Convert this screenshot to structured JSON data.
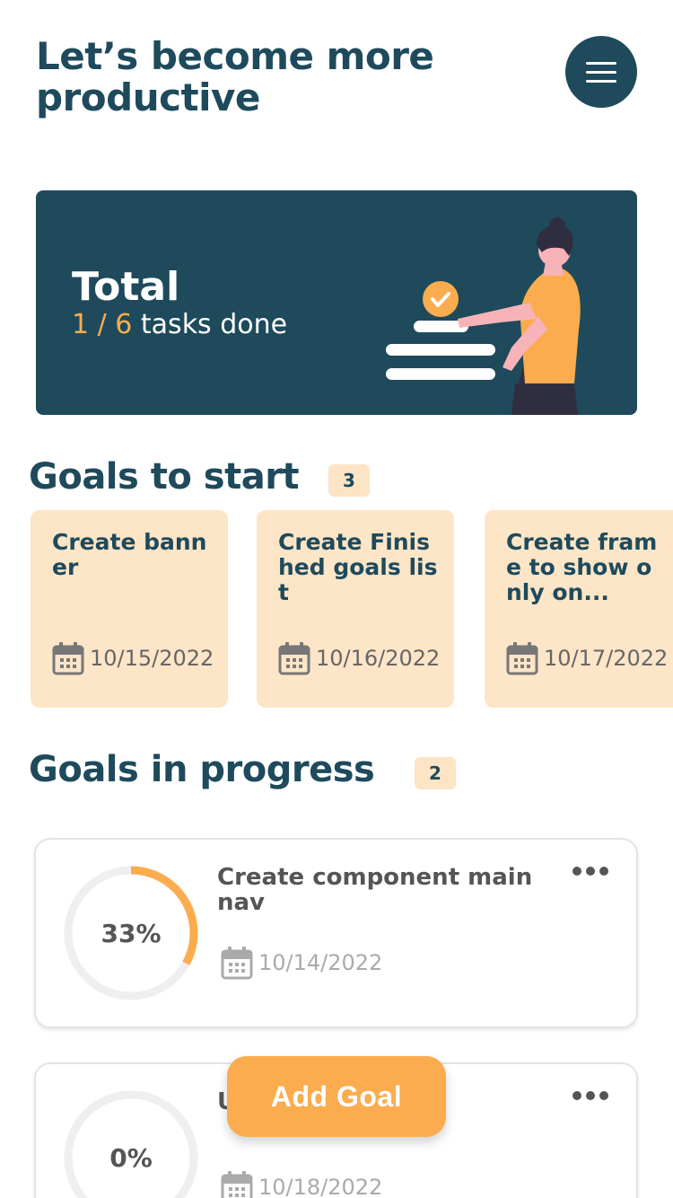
{
  "header": {
    "title": "Let’s become more productive",
    "menu_icon": "hamburger-menu-icon"
  },
  "banner": {
    "label": "Total",
    "done": "1",
    "separator": " / ",
    "total": "6",
    "suffix": " tasks done",
    "accent_color": "#fbac4f",
    "background": "#1e4a5c"
  },
  "goals_to_start": {
    "title": "Goals to start",
    "count": "3",
    "cards": [
      {
        "title": "Create banner",
        "date": "10/15/2022"
      },
      {
        "title": "Create Finished goals list",
        "date": "10/16/2022"
      },
      {
        "title": "Create frame to show only on...",
        "date": "10/17/2022"
      }
    ]
  },
  "goals_in_progress": {
    "title": "Goals in progress",
    "count": "2",
    "cards": [
      {
        "title": "Create component main nav",
        "percent_label": "33%",
        "progress": 0.33,
        "date": "10/14/2022"
      },
      {
        "title": "U",
        "percent_label": "0%",
        "progress": 0,
        "date": "10/18/2022"
      }
    ]
  },
  "add_goal": {
    "label": "Add Goal"
  },
  "colors": {
    "primary": "#1e4a5c",
    "accent": "#fbac4f",
    "card_bg": "#fde5c7"
  }
}
